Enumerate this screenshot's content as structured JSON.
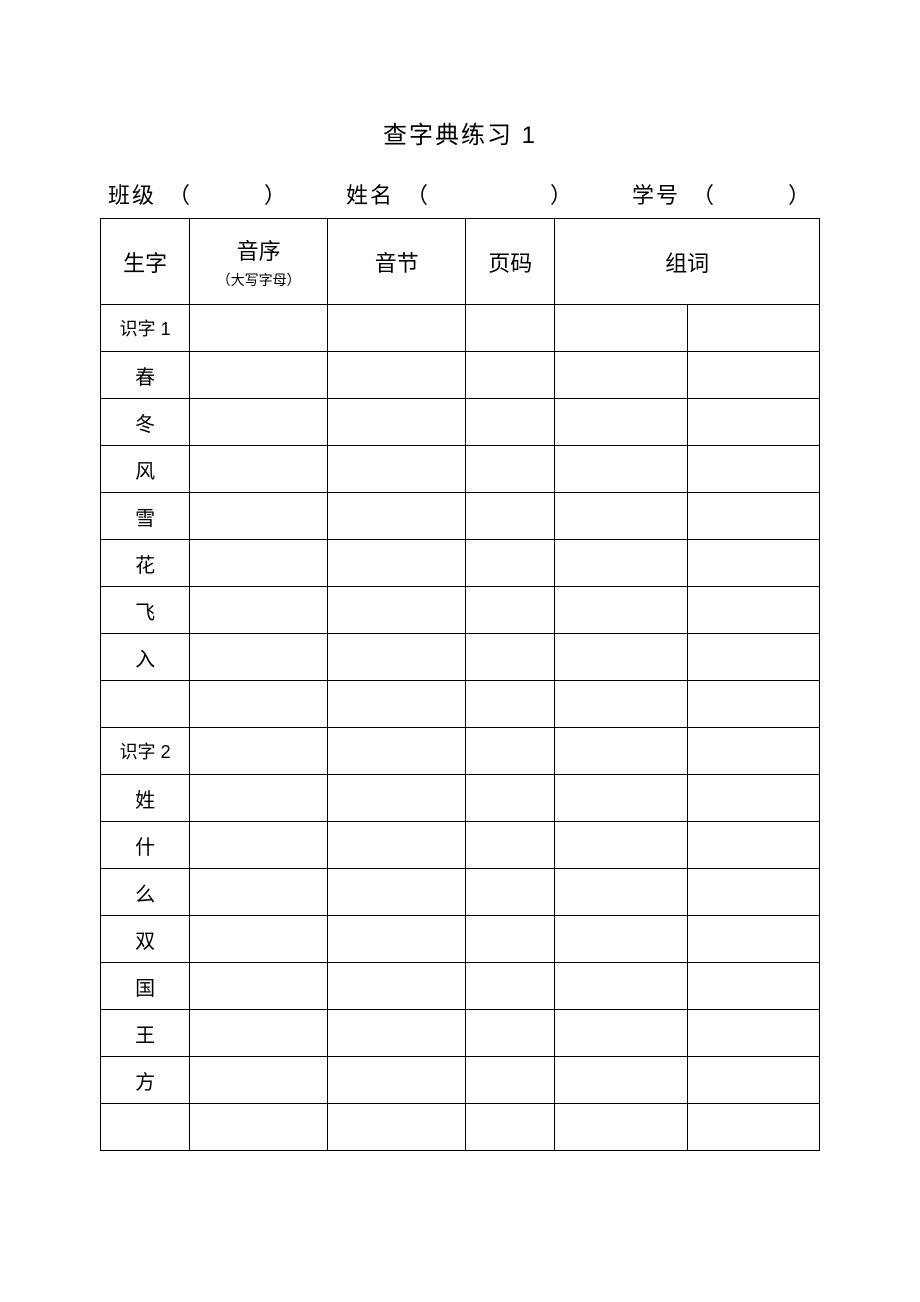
{
  "title": "查字典练习 1",
  "info": {
    "class_label": "班级",
    "class_field": "（　　　）",
    "name_label": "姓名",
    "name_field": "（　　　　　）",
    "id_label": "学号",
    "id_field": "（　　　）"
  },
  "headers": {
    "char": "生字",
    "yinxu": "音序",
    "yinxu_sub": "（大写字母）",
    "yinjie": "音节",
    "page": "页码",
    "zuci": "组词"
  },
  "rows": [
    {
      "label": "识字 1",
      "section": true
    },
    {
      "label": "春"
    },
    {
      "label": "冬"
    },
    {
      "label": "风"
    },
    {
      "label": "雪"
    },
    {
      "label": "花"
    },
    {
      "label": "飞"
    },
    {
      "label": "入"
    },
    {
      "label": ""
    },
    {
      "label": "识字 2",
      "section": true
    },
    {
      "label": "姓"
    },
    {
      "label": "什"
    },
    {
      "label": "么"
    },
    {
      "label": "双"
    },
    {
      "label": "国"
    },
    {
      "label": "王"
    },
    {
      "label": "方"
    },
    {
      "label": ""
    }
  ]
}
